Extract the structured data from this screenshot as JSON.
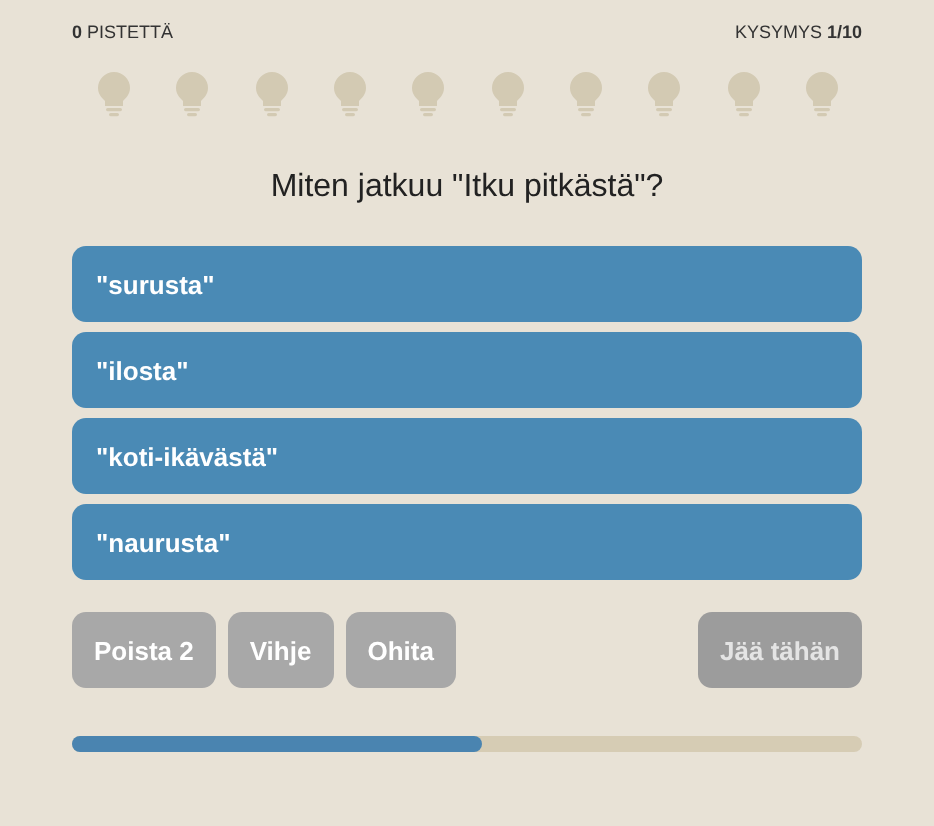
{
  "score": "**0** PISTETTÄ",
  "question_counter": "KYSYMYS **1/10**",
  "bulbs": [
    {
      "lit": false
    },
    {
      "lit": false
    },
    {
      "lit": false
    },
    {
      "lit": false
    },
    {
      "lit": false
    },
    {
      "lit": false
    },
    {
      "lit": false
    },
    {
      "lit": false
    },
    {
      "lit": false
    },
    {
      "lit": false
    }
  ],
  "question": "Miten jatkuu \"Itku pitkästä\"?",
  "answers": [
    {
      "label": "\"surusta\""
    },
    {
      "label": "\"ilosta\""
    },
    {
      "label": "\"koti-ikävästä\""
    },
    {
      "label": "\"naurusta\""
    }
  ],
  "actions": [
    {
      "label": "Poista 2",
      "disabled": false
    },
    {
      "label": "Vihje",
      "disabled": false
    },
    {
      "label": "Ohita",
      "disabled": false
    }
  ],
  "quit_button": {
    "label": "Jää tähän",
    "disabled": true
  },
  "progress": {
    "level": 0.52
  }
}
